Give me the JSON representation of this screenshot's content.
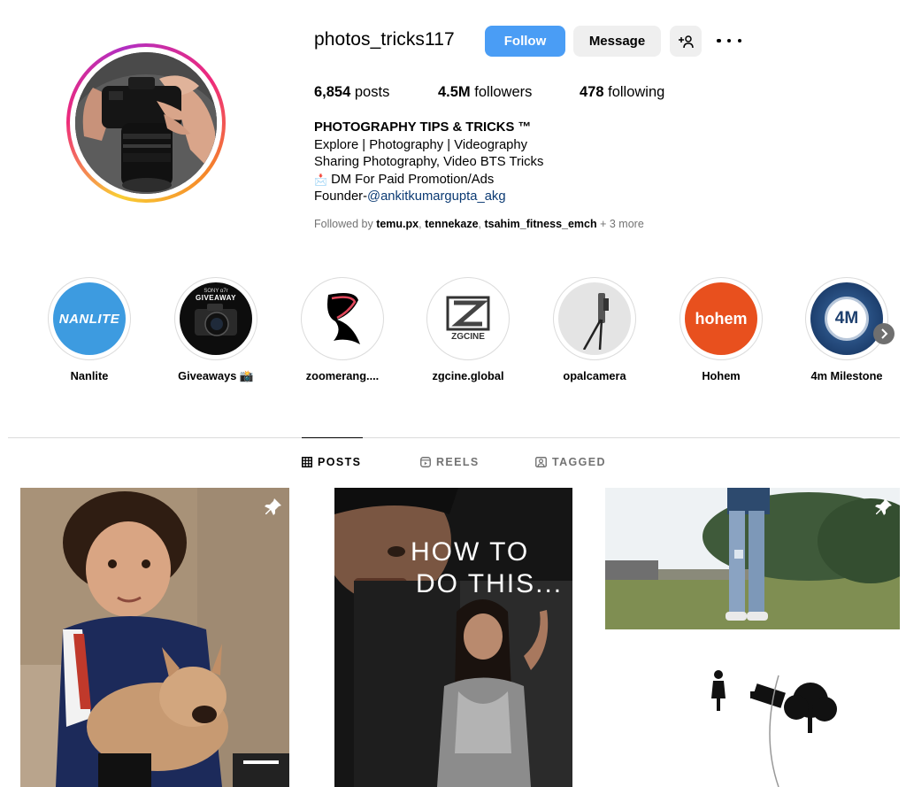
{
  "profile": {
    "username": "photos_tricks117",
    "follow_label": "Follow",
    "message_label": "Message",
    "stats": {
      "posts_count": "6,854",
      "posts_label": " posts",
      "followers_count": "4.5M",
      "followers_label": " followers",
      "following_count": "478",
      "following_label": " following"
    },
    "bio": {
      "name": "PHOTOGRAPHY TIPS & TRICKS ™",
      "line1": "Explore | Photography | Videography",
      "line2": "Sharing Photography, Video BTS Tricks",
      "line3_emoji": "📩",
      "line3": " DM For Paid Promotion/Ads",
      "line4_prefix": "Founder-",
      "line4_link": "@ankitkumargupta_akg"
    },
    "followed_by": {
      "prefix": "Followed by ",
      "user1": "temu.px",
      "sep1": ", ",
      "user2": "tennekaze",
      "sep2": ", ",
      "user3": "tsahim_fitness_emch",
      "more": " + 3 more"
    }
  },
  "highlights": [
    {
      "label": "Nanlite",
      "icon_text": "NANLITE",
      "bg": "#3d9be0"
    },
    {
      "label": "Giveaways 📸",
      "icon_text_top": "SONY α7r",
      "icon_text": "GIVEAWAY",
      "bg": "#0d0d0d"
    },
    {
      "label": "zoomerang....",
      "bg": "#ffffff"
    },
    {
      "label": "zgcine.global",
      "icon_text": "ZGCINE",
      "bg": "#ffffff"
    },
    {
      "label": "opalcamera",
      "bg": "#e4e4e4"
    },
    {
      "label": "Hohem",
      "icon_text": "hohem",
      "bg": "#e8501e"
    },
    {
      "label": "4m Milestone",
      "icon_text": "4M",
      "bg": "#1d3f6e"
    }
  ],
  "tabs": [
    {
      "label": "POSTS",
      "icon": "grid-icon",
      "active": true
    },
    {
      "label": "REELS",
      "icon": "reels-icon",
      "active": false
    },
    {
      "label": "TAGGED",
      "icon": "tagged-icon",
      "active": false
    }
  ],
  "posts": [
    {
      "pinned": true,
      "overlay_text": ""
    },
    {
      "pinned": false,
      "overlay_text_line1": "HOW TO",
      "overlay_text_line2": "DO THIS..."
    },
    {
      "pinned": true,
      "overlay_text": ""
    }
  ],
  "colors": {
    "accent": "#4a9df5",
    "secondary_button": "#efefef",
    "muted_text": "#737373",
    "link": "#0b3a73",
    "divider": "#dbdbdb"
  }
}
